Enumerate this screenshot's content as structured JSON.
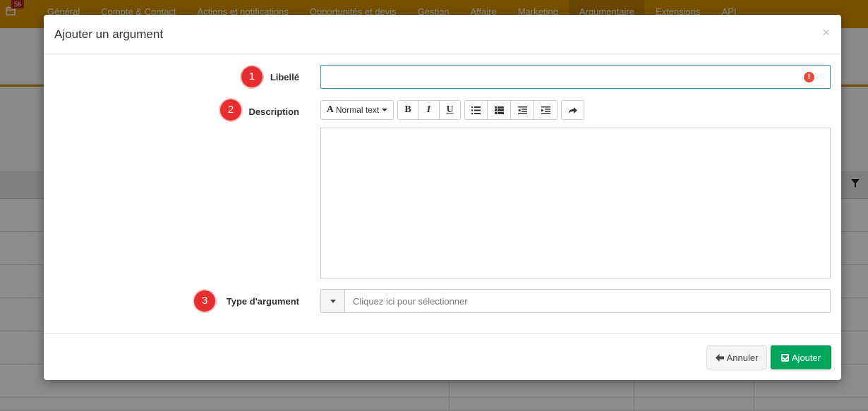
{
  "topnav": {
    "badge": "56",
    "items": [
      "Général",
      "Compte & Contact",
      "Actions et notifications",
      "Opportunités et devis",
      "Gestion",
      "Affaire",
      "Marketing",
      "Argumentaire",
      "Extensions",
      "API"
    ],
    "active": "Argumentaire"
  },
  "modal": {
    "title": "Ajouter un argument",
    "close": "×",
    "steps": [
      "1",
      "2",
      "3"
    ],
    "fields": {
      "libelle": {
        "label": "Libellé",
        "value": "",
        "error_icon": "!"
      },
      "description": {
        "label": "Description",
        "value": ""
      },
      "type": {
        "label": "Type d'argument",
        "placeholder": "Cliquez ici pour sélectionner"
      }
    },
    "toolbar": {
      "format_label": "Normal text",
      "format_glyph": "A",
      "bold": "B",
      "italic": "I",
      "underline": "U"
    },
    "footer": {
      "cancel_label": "Annuler",
      "add_label": "Ajouter"
    }
  },
  "colors": {
    "topnav": "#d99300",
    "step_badge": "#e62e2e",
    "input_focus": "#3c8dbc",
    "add_button": "#00a65a"
  }
}
